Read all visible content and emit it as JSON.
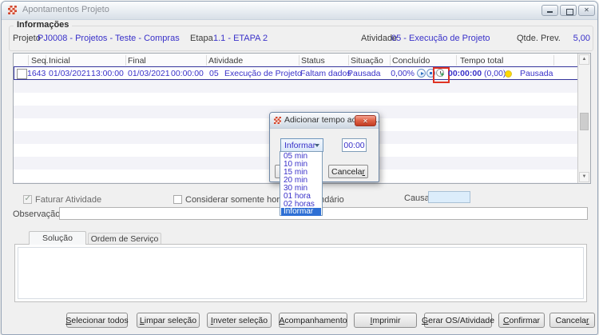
{
  "window": {
    "title": "Apontamentos Projeto",
    "close_glyph": "✕"
  },
  "info": {
    "section_title": "Informações",
    "projeto_label": "Projeto",
    "projeto_value": "PJ0008 - Projetos - Teste - Compras",
    "etapa_label": "Etapa",
    "etapa_value": "1.1 - ETAPA 2",
    "atividade_label": "Atividade",
    "atividade_value": "05 - Execução de Projeto",
    "qtde_label": "Qtde. Prev.",
    "qtde_value": "5,00"
  },
  "grid": {
    "columns": [
      "Seq.",
      "Inicial",
      "Final",
      "Atividade",
      "Status",
      "Situação",
      "Concluído",
      "Tempo total"
    ],
    "row": {
      "seq": "1643",
      "inicial_date": "01/03/2021",
      "inicial_time": "13:00:00",
      "final_date": "01/03/2021",
      "final_time": "00:00:00",
      "atividade_code": "05",
      "atividade_desc": "Execução de Projeto",
      "status": "Faltam dados",
      "situacao": "Pausada",
      "concluido": "0,00%",
      "tempo_total": "00:00:00",
      "tempo_decimal": "(0,00)",
      "estado": "Pausada"
    },
    "icons": [
      "play-icon",
      "stop-icon",
      "add-time-clock-icon"
    ]
  },
  "options_row": {
    "faturar_label": "Faturar Atividade",
    "faturar_check": "✓",
    "considerar_label": "Considerar somente horas do calendário",
    "causa_label": "Causa"
  },
  "observacao_label": "Observação",
  "tabs": {
    "solucao": "Solução",
    "ordem": "Ordem de Serviço"
  },
  "footer_buttons": [
    {
      "pre": "",
      "accel": "S",
      "rest": "elecionar todos"
    },
    {
      "pre": "",
      "accel": "L",
      "rest": "impar seleção"
    },
    {
      "pre": "",
      "accel": "I",
      "rest": "nveter seleção"
    },
    {
      "pre": "",
      "accel": "A",
      "rest": "companhamento"
    },
    {
      "pre": "",
      "accel": "I",
      "rest": "mprimir"
    },
    {
      "pre": "",
      "accel": "G",
      "rest": "erar OS/Atividade"
    },
    {
      "pre": "",
      "accel": "C",
      "rest": "onfirmar"
    },
    {
      "pre": "Cancela",
      "accel": "r",
      "rest": ""
    }
  ],
  "dialog": {
    "title": "Adicionar tempo ao apo...",
    "close_glyph": "✕",
    "combo_value": "Informar",
    "time_value": "00:00",
    "cancel_pre": "Cancela",
    "cancel_accel": "r",
    "options": [
      "05 min",
      "10 min",
      "15 min",
      "20 min",
      "30 min",
      "01 hora",
      "02 horas",
      "Informar"
    ],
    "selected_option": "Informar"
  },
  "colors": {
    "value_text": "#3931c9",
    "selected_row_border": "#34349b",
    "highlight_annotation": "#e03424",
    "status_dot": "#ffd900",
    "list_selection": "#2e6fd4"
  }
}
